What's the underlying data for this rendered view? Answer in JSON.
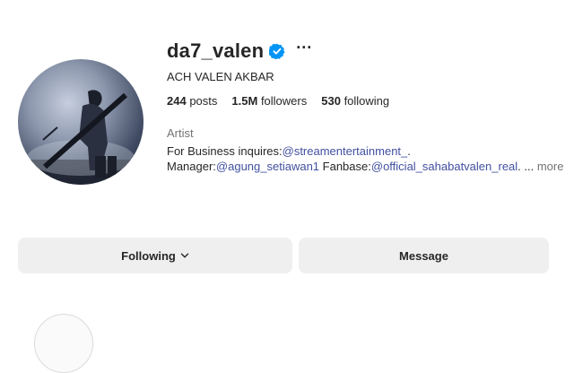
{
  "profile": {
    "username": "da7_valen",
    "full_name": "ACH VALEN AKBAR",
    "verified_icon": "verified-badge-icon",
    "more_icon": "more-options-icon"
  },
  "stats": {
    "posts_count": "244",
    "posts_label": "posts",
    "followers_count": "1.5M",
    "followers_label": "followers",
    "following_count": "530",
    "following_label": "following"
  },
  "bio": {
    "category": "Artist",
    "line1_text": "For Business inquires:",
    "line1_mention": "@streamentertainment_",
    "line1_end": ".",
    "line2_prefix": "Manager:",
    "line2_mention1": "@agung_setiawan1",
    "line2_mid": " Fanbase:",
    "line2_mention2": "@official_sahabatvalen_real",
    "line2_ellipsis": ". ... ",
    "more_label": "more"
  },
  "actions": {
    "following_label": "Following",
    "message_label": "Message"
  },
  "colors": {
    "verified": "#0095f6",
    "mention": "#4150a0",
    "button_bg": "#efefef"
  }
}
